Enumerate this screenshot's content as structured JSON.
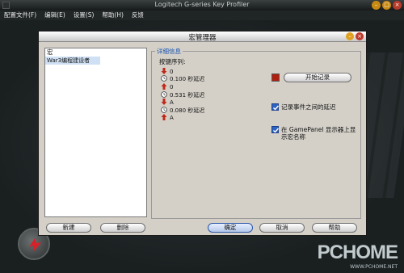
{
  "app": {
    "title": "Logitech G-series Key Profiler",
    "menu": [
      "配置文件(F)",
      "编辑(E)",
      "设置(S)",
      "帮助(H)",
      "反馈"
    ],
    "window_buttons": [
      "minimize",
      "maximize",
      "close"
    ]
  },
  "dialog": {
    "title": "宏管理器",
    "macro_list": {
      "header": "宏",
      "items": [
        "War3编程建设者"
      ]
    },
    "details": {
      "legend": "详细信息",
      "sequence_label": "按键序列:",
      "sequence": [
        {
          "type": "key-down",
          "text": "0"
        },
        {
          "type": "delay",
          "text": "0.100  秒延迟"
        },
        {
          "type": "key-up",
          "text": "0"
        },
        {
          "type": "delay",
          "text": "0.531  秒延迟"
        },
        {
          "type": "key-down",
          "text": "A"
        },
        {
          "type": "delay",
          "text": "0.080  秒延迟"
        },
        {
          "type": "key-up",
          "text": "A"
        }
      ]
    },
    "record_button": "开始记录",
    "options": [
      {
        "label": "记录事件之间的延迟",
        "checked": true
      },
      {
        "label": "在 GamePanel 显示器上显示宏名称",
        "checked": true
      }
    ],
    "buttons": {
      "new": "新建",
      "delete": "删除",
      "ok": "确定",
      "cancel": "取消",
      "help": "帮助"
    }
  },
  "watermark": {
    "brand": "PCHOME",
    "url": "WWW.PCHOME.NET"
  },
  "colors": {
    "accent": "#2c63c4",
    "key_down": "#c0281a",
    "key_up": "#c0281a"
  }
}
